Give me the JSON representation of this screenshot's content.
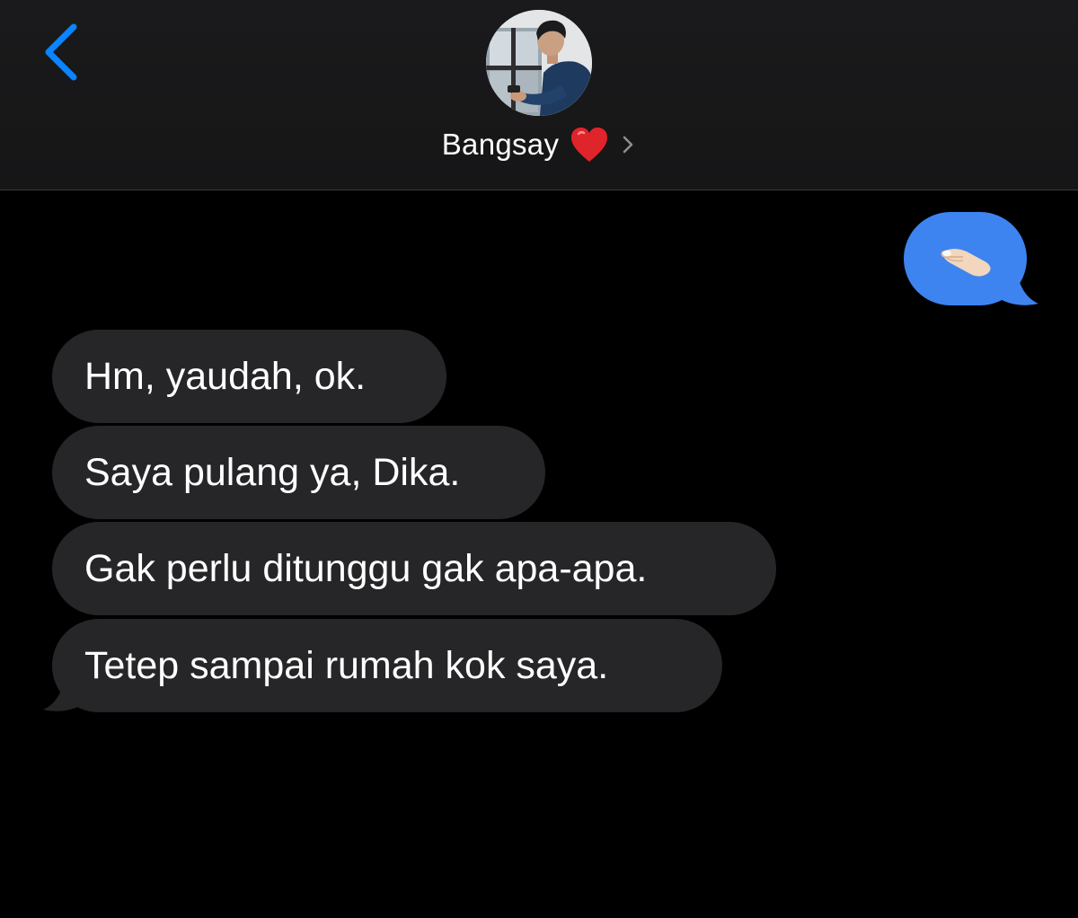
{
  "header": {
    "contact_name": "Bangsay",
    "icons": {
      "back": "chevron-left-icon",
      "heart": "red-heart-icon",
      "details": "chevron-right-icon"
    }
  },
  "colors": {
    "accent": "#0a84ff",
    "sent_bubble": "#3d84f0",
    "received_bubble": "#262628",
    "background": "#000000"
  },
  "messages": [
    {
      "direction": "sent",
      "content": "pinching-hand-emoji"
    },
    {
      "direction": "received",
      "text": "Hm, yaudah, ok."
    },
    {
      "direction": "received",
      "text": "Saya pulang ya, Dika."
    },
    {
      "direction": "received",
      "text": "Gak perlu ditunggu gak apa-apa."
    },
    {
      "direction": "received",
      "text": "Tetep sampai rumah kok saya."
    }
  ]
}
